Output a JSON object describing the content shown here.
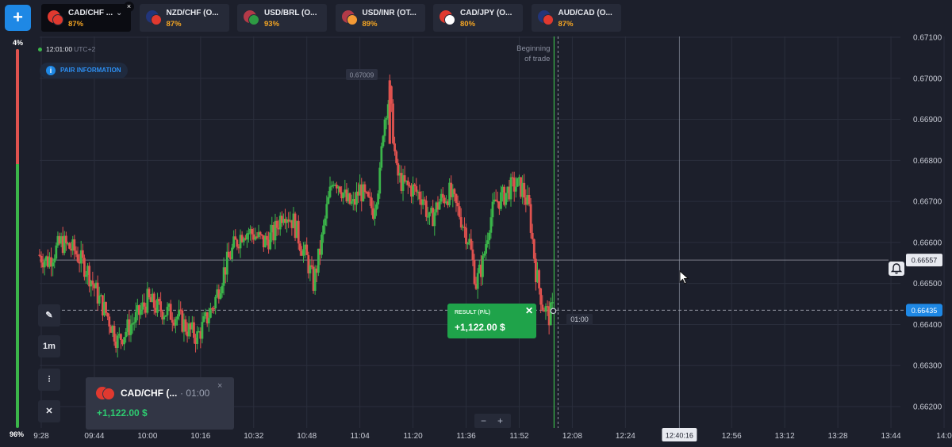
{
  "header": {
    "add_label": "+",
    "tabs": [
      {
        "name": "CAD/CHF ...",
        "pct": "87%",
        "active": true,
        "flag": "#e0392f",
        "flag2": "#e0392f"
      },
      {
        "name": "NZD/CHF (O...",
        "pct": "87%",
        "flag": "#22357a",
        "flag2": "#e0392f"
      },
      {
        "name": "USD/BRL (O...",
        "pct": "93%",
        "flag": "#b23a48",
        "flag2": "#2e9b43"
      },
      {
        "name": "USD/INR (OT...",
        "pct": "89%",
        "flag": "#b23a48",
        "flag2": "#f49a35"
      },
      {
        "name": "CAD/JPY (O...",
        "pct": "80%",
        "flag": "#e0392f",
        "flag2": "#ffffff"
      },
      {
        "name": "AUD/CAD (O...",
        "pct": "87%",
        "flag": "#22357a",
        "flag2": "#e0392f"
      }
    ]
  },
  "sentiment": {
    "up_pct": "4%",
    "down_pct": "96%"
  },
  "clock": {
    "time": "12:01:00",
    "tz": "UTC+2"
  },
  "pair_info": {
    "label": "PAIR INFORMATION",
    "icon": "info-icon"
  },
  "tools": [
    {
      "name": "draw-tool-button",
      "icon": "pencil-icon",
      "label": "✎"
    },
    {
      "name": "timeframe-button",
      "label": "1m"
    },
    {
      "name": "chart-type-button",
      "icon": "candles-icon",
      "label": "⫶"
    },
    {
      "name": "indicators-button",
      "icon": "indicators-icon",
      "label": "✕"
    }
  ],
  "trade_box": {
    "pair": "CAD/CHF (...",
    "timer": "· 01:00",
    "profit": "+1,122.00 $",
    "close": "×"
  },
  "result_card": {
    "label": "RESULT (P/L)",
    "value": "+1,122.00 $",
    "close": "✕"
  },
  "trade_marker": {
    "label": "Beginning of trade",
    "line1": "Beginning",
    "line2": "of trade"
  },
  "expiry_label": "01:00",
  "zoom": {
    "minus": "−",
    "plus": "+"
  },
  "cursor_time": "12:40:16",
  "colors": {
    "up": "#3bb54a",
    "down": "#e0524f",
    "accent": "#1e88e5",
    "profit": "#1fa34a"
  },
  "chart_data": {
    "type": "candlestick",
    "price_labels": [
      "0.67100",
      "0.67000",
      "0.66900",
      "0.66800",
      "0.66700",
      "0.66600",
      "0.66500",
      "0.66400",
      "0.66300",
      "0.66200"
    ],
    "price_values": [
      0.671,
      0.67,
      0.669,
      0.668,
      0.667,
      0.666,
      0.665,
      0.664,
      0.663,
      0.662
    ],
    "time_labels": [
      "9:28",
      "09:44",
      "10:00",
      "10:16",
      "10:32",
      "10:48",
      "11:04",
      "11:20",
      "11:36",
      "11:52",
      "12:08",
      "12:24",
      "12:40:16",
      "12:56",
      "13:12",
      "13:28",
      "13:44",
      "14:0"
    ],
    "time_minutes": [
      568,
      584,
      600,
      616,
      632,
      648,
      664,
      680,
      696,
      712,
      728,
      744,
      760.27,
      776,
      792,
      808,
      824,
      840
    ],
    "current_price": "0.66435",
    "current_price_value": 0.66435,
    "alert_price": "0.66557",
    "alert_price_value": 0.66557,
    "high_label": "0.67009",
    "high_value": 0.67009,
    "trade_start_minute": 722.5,
    "cursor_minute": 760.27,
    "close_path": [
      [
        567,
        0.6657
      ],
      [
        570,
        0.66555
      ],
      [
        574,
        0.666
      ],
      [
        578,
        0.6658
      ],
      [
        582,
        0.6653
      ],
      [
        585,
        0.6647
      ],
      [
        588,
        0.6642
      ],
      [
        591,
        0.6636
      ],
      [
        594,
        0.6639
      ],
      [
        597,
        0.6642
      ],
      [
        600,
        0.6646
      ],
      [
        603,
        0.6644
      ],
      [
        606,
        0.6643
      ],
      [
        609,
        0.6642
      ],
      [
        612,
        0.6639
      ],
      [
        615,
        0.6637
      ],
      [
        617,
        0.664
      ],
      [
        620,
        0.6645
      ],
      [
        623,
        0.6653
      ],
      [
        626,
        0.6659
      ],
      [
        629,
        0.6663
      ],
      [
        632,
        0.6662
      ],
      [
        635,
        0.666
      ],
      [
        638,
        0.6662
      ],
      [
        641,
        0.6668
      ],
      [
        644,
        0.6665
      ],
      [
        646,
        0.666
      ],
      [
        648,
        0.6656
      ],
      [
        650,
        0.665
      ],
      [
        652,
        0.6658
      ],
      [
        654,
        0.6668
      ],
      [
        656,
        0.6676
      ],
      [
        658,
        0.6674
      ],
      [
        660,
        0.667
      ],
      [
        662,
        0.6669
      ],
      [
        664,
        0.6673
      ],
      [
        666,
        0.667
      ],
      [
        668,
        0.6668
      ],
      [
        670,
        0.6676
      ],
      [
        671,
        0.6688
      ],
      [
        672,
        0.6693
      ],
      [
        673,
        0.6696
      ],
      [
        675,
        0.6677
      ],
      [
        677,
        0.6674
      ],
      [
        680,
        0.6673
      ],
      [
        683,
        0.6671
      ],
      [
        685,
        0.6665
      ],
      [
        688,
        0.667
      ],
      [
        691,
        0.6672
      ],
      [
        694,
        0.6667
      ],
      [
        697,
        0.666
      ],
      [
        699,
        0.665
      ],
      [
        701,
        0.6655
      ],
      [
        703,
        0.6665
      ],
      [
        705,
        0.667
      ],
      [
        707,
        0.6671
      ],
      [
        709,
        0.6673
      ],
      [
        711,
        0.6674
      ],
      [
        713,
        0.6673
      ],
      [
        715,
        0.6668
      ],
      [
        717,
        0.6653
      ],
      [
        719,
        0.6645
      ],
      [
        721,
        0.6642
      ],
      [
        722,
        0.66435
      ]
    ]
  }
}
